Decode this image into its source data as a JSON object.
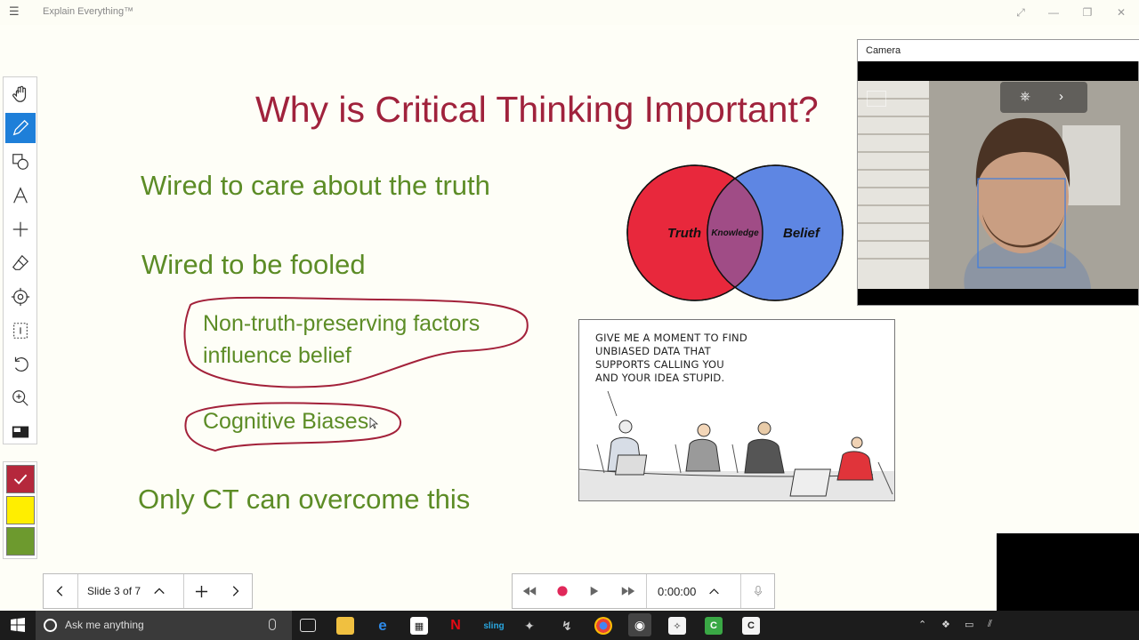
{
  "app": {
    "title": "Explain Everything™"
  },
  "slide": {
    "title": "Why is Critical Thinking Important?",
    "bullets": [
      "Wired to care about the truth",
      "Wired to be fooled",
      "Only CT can overcome this"
    ],
    "sub_bullets": [
      "Non-truth-preserving factors influence belief",
      "Cognitive Biases"
    ]
  },
  "venn": {
    "left_label": "Truth",
    "overlap_label": "Knowledge",
    "right_label": "Belief",
    "colors": {
      "left": "#e8283c",
      "right": "#5e86e3",
      "overlap": "#a04c86"
    }
  },
  "cartoon": {
    "caption_lines": [
      "GIVE ME A MOMENT TO FIND",
      "UNBIASED DATA THAT",
      "SUPPORTS CALLING YOU",
      "AND YOUR IDEA STUPID."
    ]
  },
  "camera": {
    "title": "Camera"
  },
  "navigation": {
    "slide_label": "Slide 3 of 7"
  },
  "recorder": {
    "time": "0:00:00"
  },
  "palette": {
    "colors": [
      "#b5283c",
      "#ffee00",
      "#6d9a2e"
    ]
  },
  "taskbar": {
    "search_placeholder": "Ask me anything"
  },
  "colors": {
    "title": "#a0223c",
    "text": "#5c8c26",
    "annotation": "#a3213a",
    "accent": "#1e7fd9"
  }
}
